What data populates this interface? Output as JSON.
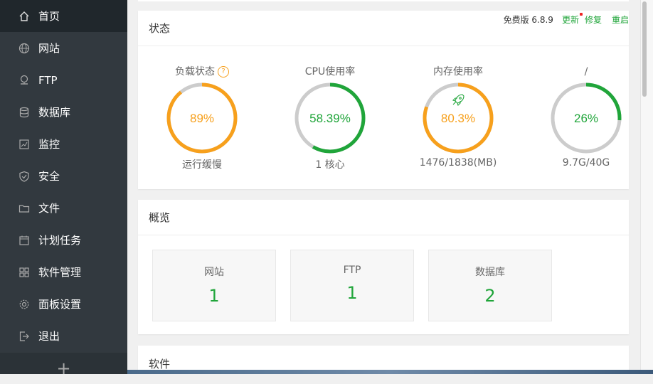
{
  "sidebar": {
    "items": [
      {
        "label": "首页",
        "icon": "home-icon",
        "active": true
      },
      {
        "label": "网站",
        "icon": "globe-icon"
      },
      {
        "label": "FTP",
        "icon": "ftp-icon"
      },
      {
        "label": "数据库",
        "icon": "database-icon"
      },
      {
        "label": "监控",
        "icon": "monitor-icon"
      },
      {
        "label": "安全",
        "icon": "shield-icon"
      },
      {
        "label": "文件",
        "icon": "folder-icon"
      },
      {
        "label": "计划任务",
        "icon": "calendar-icon"
      },
      {
        "label": "软件管理",
        "icon": "apps-icon"
      },
      {
        "label": "面板设置",
        "icon": "gear-icon"
      },
      {
        "label": "退出",
        "icon": "logout-icon"
      }
    ],
    "add_label": "+"
  },
  "status": {
    "title": "状态",
    "version_label": "免费版 6.8.9",
    "update_label": "更新",
    "repair_label": "修复",
    "restart_label": "重启",
    "gauges": [
      {
        "title": "负载状态",
        "value": "89%",
        "percent": 89,
        "sub": "运行缓慢",
        "color": "#f7a01c",
        "help": "?"
      },
      {
        "title": "CPU使用率",
        "value": "58.39%",
        "percent": 58.39,
        "sub": "1 核心",
        "color": "#20a53a"
      },
      {
        "title": "内存使用率",
        "value": "80.3%",
        "percent": 80.3,
        "sub": "1476/1838(MB)",
        "color": "#f7a01c",
        "icon": "rocket-icon"
      },
      {
        "title": "/",
        "value": "26%",
        "percent": 26,
        "sub": "9.7G/40G",
        "color": "#20a53a"
      }
    ]
  },
  "overview": {
    "title": "概览",
    "cards": [
      {
        "label": "网站",
        "value": "1"
      },
      {
        "label": "FTP",
        "value": "1"
      },
      {
        "label": "数据库",
        "value": "2"
      }
    ]
  },
  "software": {
    "title": "软件"
  },
  "colors": {
    "sidebar_bg": "#32393f",
    "sidebar_active": "#20272c",
    "accent_green": "#20a53a",
    "warn_orange": "#f7a01c",
    "track_gray": "#cccccc"
  }
}
